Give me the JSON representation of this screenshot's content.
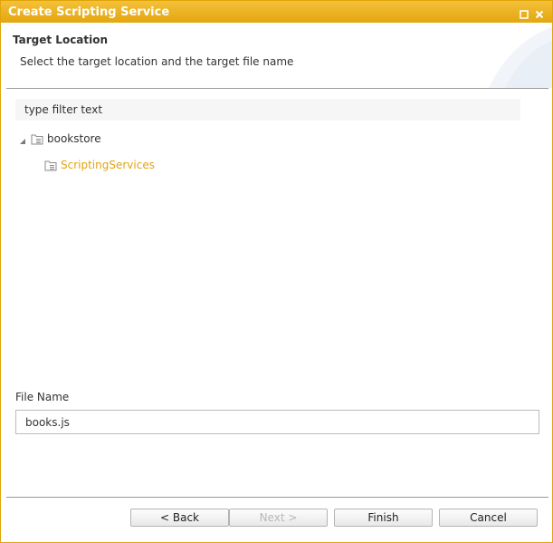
{
  "window": {
    "title": "Create Scripting Service",
    "controls": [
      "maximize-icon",
      "close-icon"
    ]
  },
  "header": {
    "title": "Target Location",
    "description": "Select the target location and the target file name"
  },
  "filter": {
    "placeholder": "type filter text"
  },
  "tree": {
    "root": {
      "label": "bookstore",
      "expanded": true,
      "icon": "folder-icon"
    },
    "child": {
      "label": "ScriptingServices",
      "selected": true,
      "icon": "folder-icon"
    }
  },
  "file": {
    "label": "File Name",
    "value": "books.js"
  },
  "buttons": {
    "back": "< Back",
    "next": "Next >",
    "next_enabled": false,
    "finish": "Finish",
    "cancel": "Cancel"
  },
  "colors": {
    "accent": "#e3a60f",
    "selected_text": "#e3a311"
  }
}
